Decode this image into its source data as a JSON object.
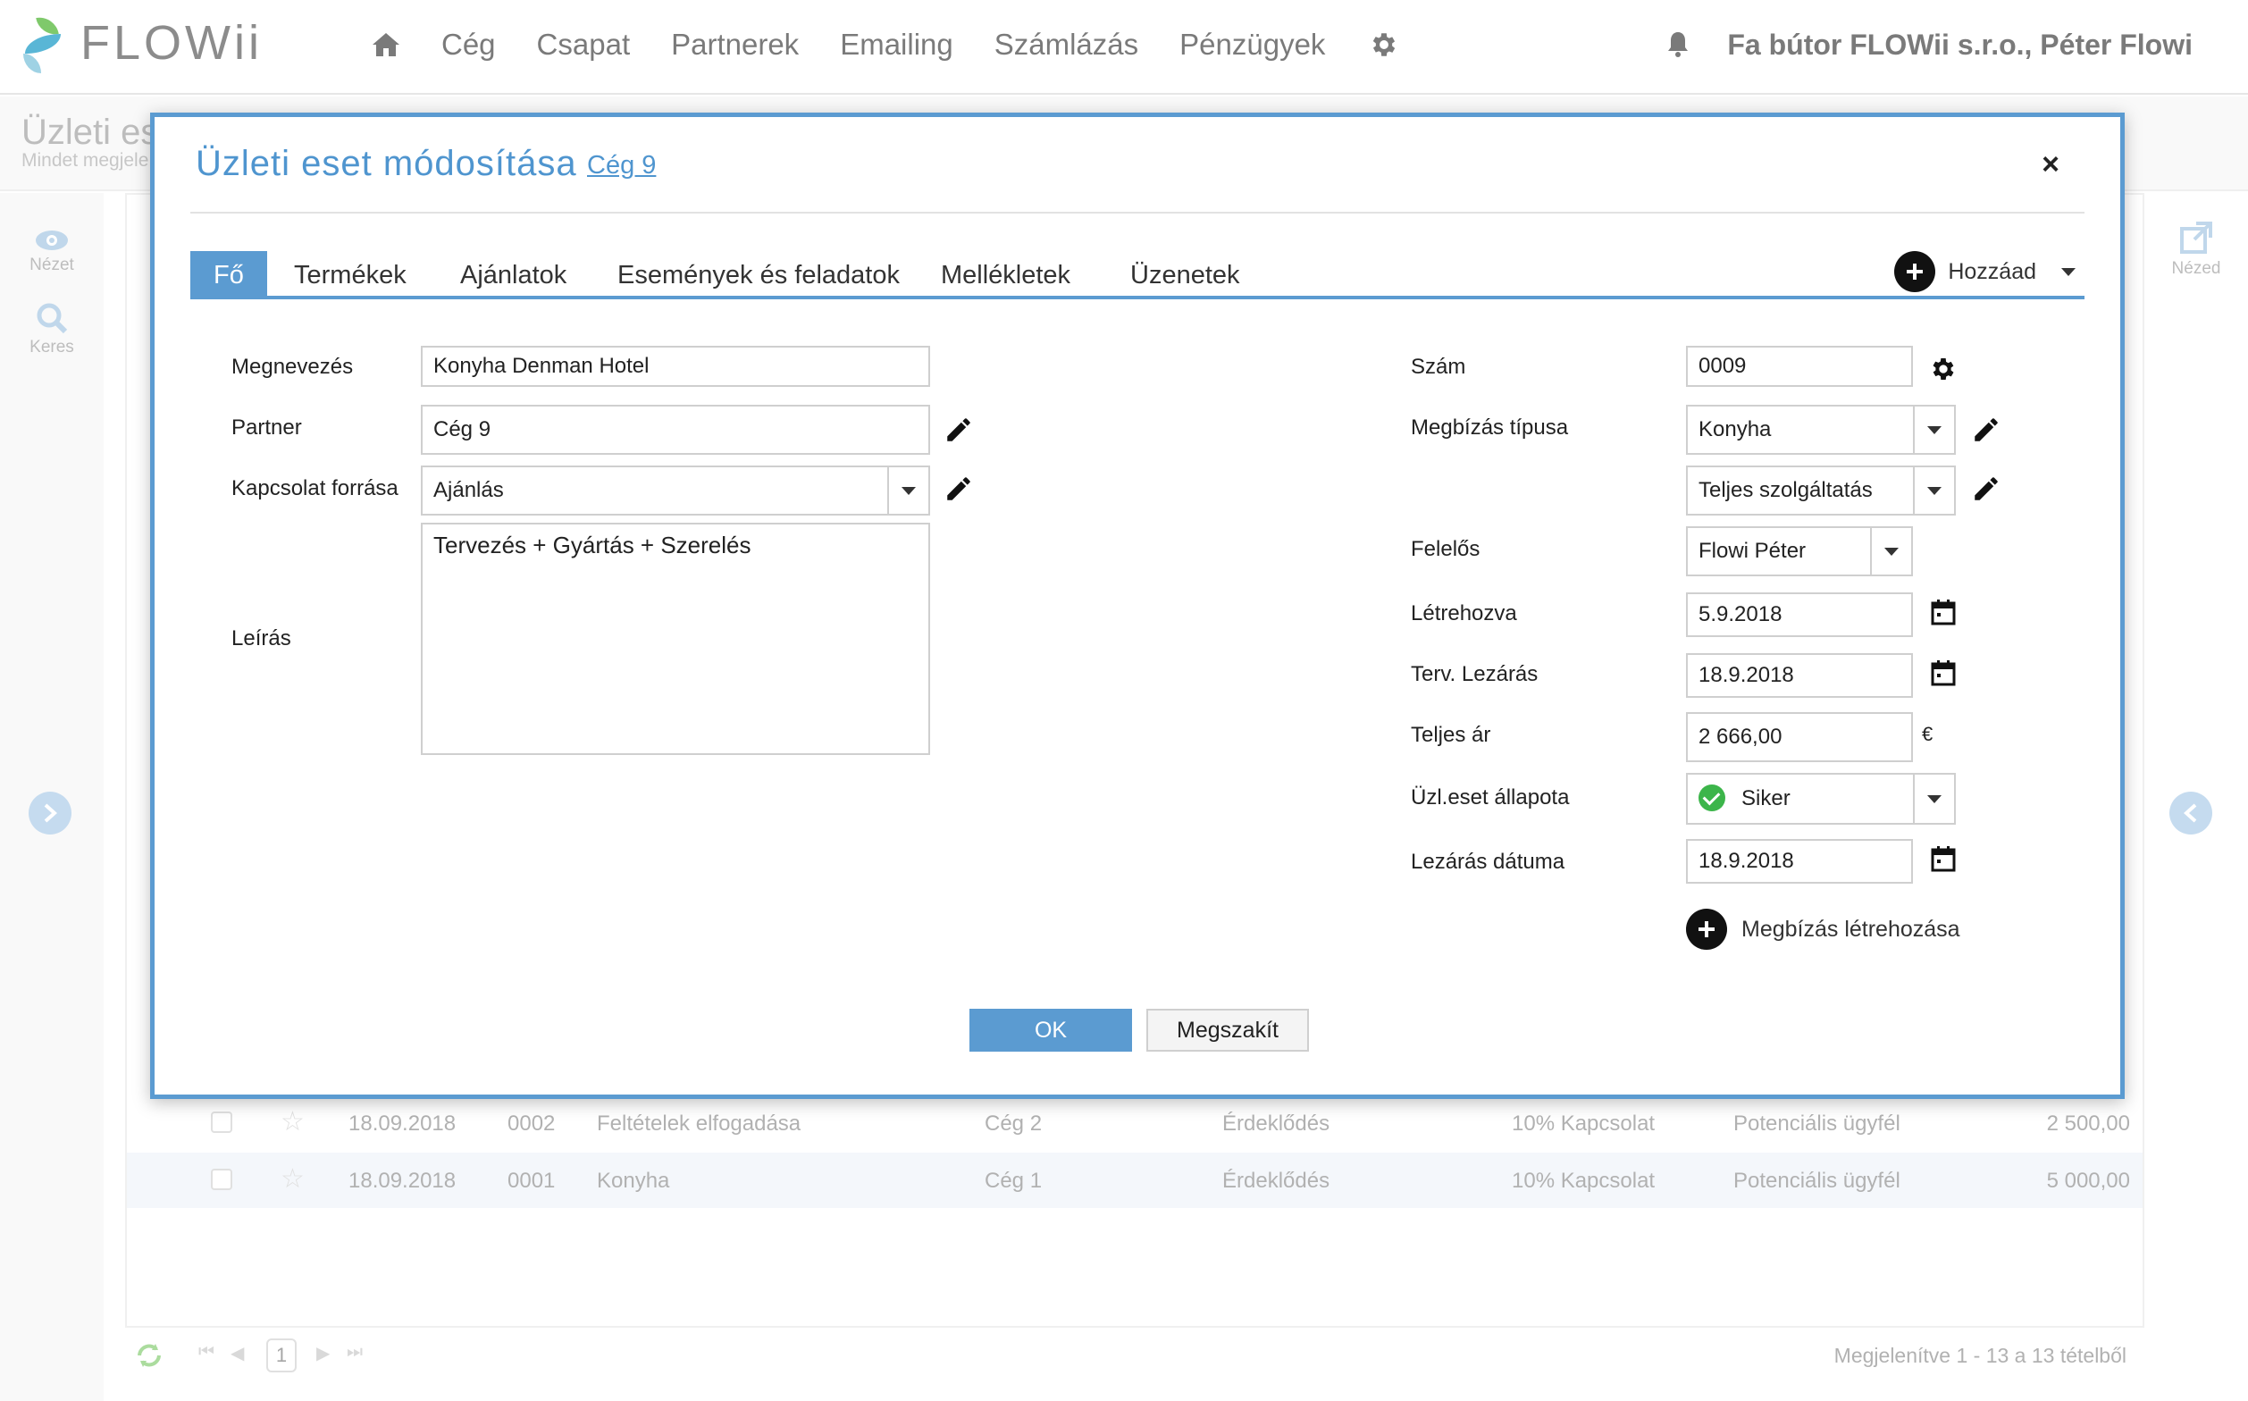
{
  "app": {
    "logo_text": "FLOWii"
  },
  "nav": {
    "items": [
      "Cég",
      "Csapat",
      "Partnerek",
      "Emailing",
      "Számlázás",
      "Pénzügyek"
    ]
  },
  "user": {
    "name": "Fa bútor FLOWii s.r.o., Péter Flowi"
  },
  "page": {
    "title": "Üzleti es",
    "subtitle": "Mindet megjele"
  },
  "rail": {
    "view_label": "Nézet",
    "search_label": "Keres",
    "right_label": "Nézed"
  },
  "grid": {
    "rows": [
      {
        "date": "18.09.2018",
        "num": "0002",
        "name": "Feltételek elfogadása",
        "partner": "Cég 2",
        "stage": "Érdeklődés",
        "prob": "10% Kapcsolat",
        "status": "Potenciális ügyfél",
        "amount": "2 500,00"
      },
      {
        "date": "18.09.2018",
        "num": "0001",
        "name": "Konyha",
        "partner": "Cég 1",
        "stage": "Érdeklődés",
        "prob": "10% Kapcsolat",
        "status": "Potenciális ügyfél",
        "amount": "5 000,00"
      }
    ]
  },
  "footer": {
    "page": "1",
    "summary": "Megjelenítve 1 - 13 a 13 tételből"
  },
  "modal": {
    "title": "Üzleti eset módosítása",
    "link": "Cég 9",
    "close": "×",
    "tabs": [
      "Fő",
      "Termékek",
      "Ajánlatok",
      "Események és feladatok",
      "Mellékletek",
      "Üzenetek"
    ],
    "add_label": "Hozzáad",
    "left": {
      "name_label": "Megnevezés",
      "name_value": "Konyha Denman Hotel",
      "partner_label": "Partner",
      "partner_value": "Cég 9",
      "source_label": "Kapcsolat forrása",
      "source_value": "Ajánlás",
      "desc_label": "Leírás",
      "desc_value": "Tervezés + Gyártás + Szerelés"
    },
    "right": {
      "number_label": "Szám",
      "number_value": "0009",
      "type_label": "Megbízás típusa",
      "type_value": "Konyha",
      "service_value": "Teljes szolgáltatás",
      "owner_label": "Felelős",
      "owner_value": "Flowi Péter",
      "created_label": "Létrehozva",
      "created_value": "5.9.2018",
      "planned_label": "Terv. Lezárás",
      "planned_value": "18.9.2018",
      "price_label": "Teljes ár",
      "price_value": "2 666,00",
      "currency": "€",
      "state_label": "Üzl.eset állapota",
      "state_value": "Siker",
      "closed_label": "Lezárás dátuma",
      "closed_value": "18.9.2018"
    },
    "create_label": "Megbízás létrehozása",
    "ok_label": "OK",
    "cancel_label": "Megszakít"
  },
  "colors": {
    "accent": "#5b9bd1",
    "success": "#3cb54a"
  }
}
